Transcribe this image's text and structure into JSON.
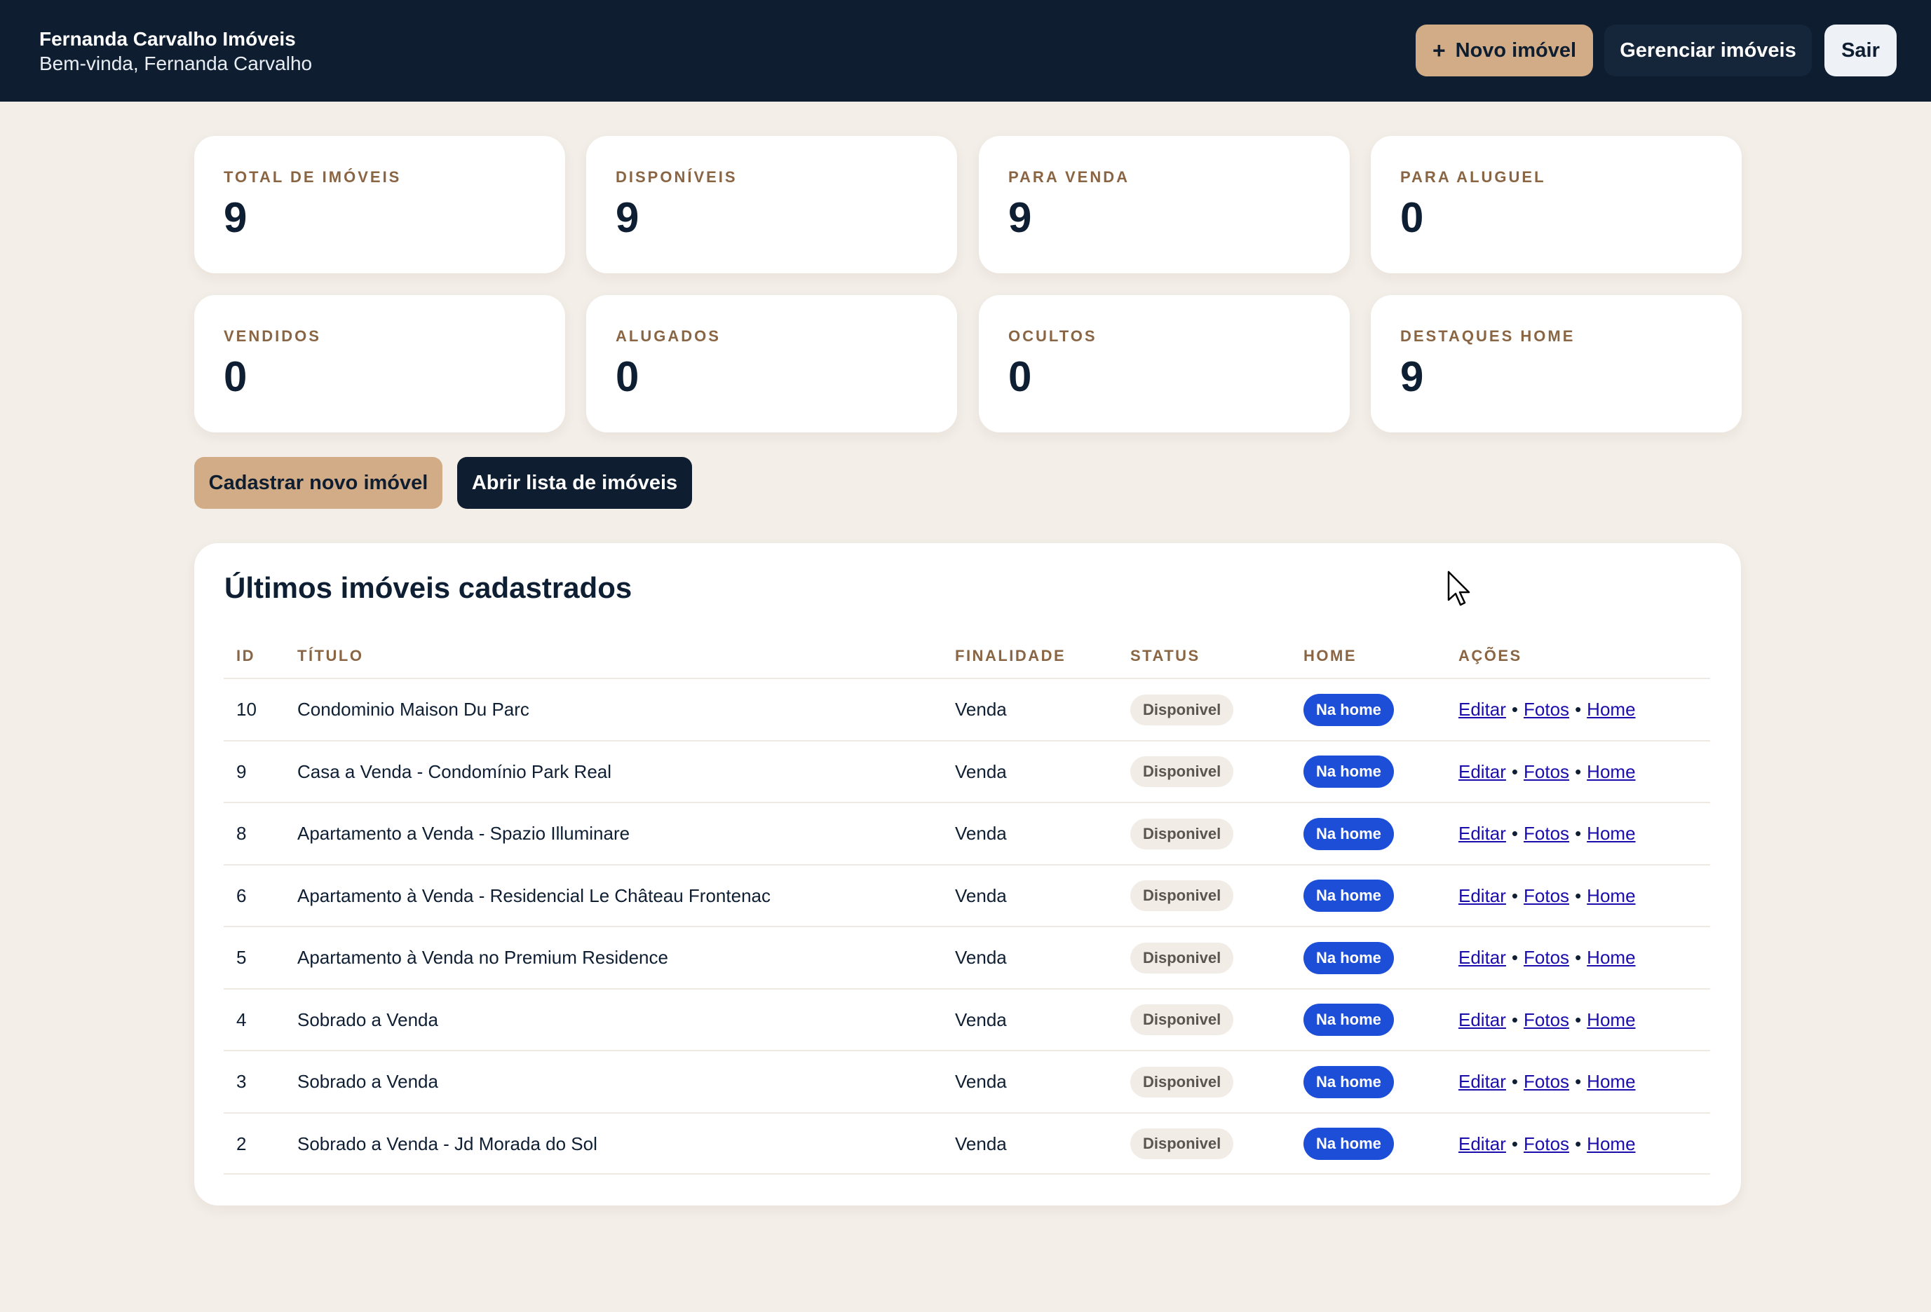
{
  "header": {
    "brand_name": "Fernanda Carvalho Imóveis",
    "welcome": "Bem-vinda, Fernanda Carvalho",
    "novo_imovel_label": "Novo imóvel",
    "gerenciar_label": "Gerenciar imóveis",
    "sair_label": "Sair",
    "colors": {
      "bar": "#0e1e30",
      "accent": "#d2ac86"
    }
  },
  "stats": [
    {
      "label": "TOTAL DE IMÓVEIS",
      "value": "9"
    },
    {
      "label": "DISPONÍVEIS",
      "value": "9"
    },
    {
      "label": "PARA VENDA",
      "value": "9"
    },
    {
      "label": "PARA ALUGUEL",
      "value": "0"
    },
    {
      "label": "VENDIDOS",
      "value": "0"
    },
    {
      "label": "ALUGADOS",
      "value": "0"
    },
    {
      "label": "OCULTOS",
      "value": "0"
    },
    {
      "label": "DESTAQUES HOME",
      "value": "9"
    }
  ],
  "actions": {
    "cadastrar_label": "Cadastrar novo imóvel",
    "abrir_label": "Abrir lista de imóveis"
  },
  "table": {
    "title": "Últimos imóveis cadastrados",
    "headers": [
      "ID",
      "TÍTULO",
      "FINALIDADE",
      "STATUS",
      "HOME",
      "AÇÕES"
    ],
    "action_links": [
      "Editar",
      "Fotos",
      "Home"
    ],
    "rows": [
      {
        "id": "10",
        "titulo": "Condominio Maison Du Parc",
        "finalidade": "Venda",
        "status": "Disponivel",
        "home": "Na home"
      },
      {
        "id": "9",
        "titulo": "Casa a Venda - Condomínio Park Real",
        "finalidade": "Venda",
        "status": "Disponivel",
        "home": "Na home"
      },
      {
        "id": "8",
        "titulo": "Apartamento a Venda - Spazio Illuminare",
        "finalidade": "Venda",
        "status": "Disponivel",
        "home": "Na home"
      },
      {
        "id": "6",
        "titulo": "Apartamento à Venda - Residencial Le Château Frontenac",
        "finalidade": "Venda",
        "status": "Disponivel",
        "home": "Na home"
      },
      {
        "id": "5",
        "titulo": "Apartamento à Venda no Premium Residence",
        "finalidade": "Venda",
        "status": "Disponivel",
        "home": "Na home"
      },
      {
        "id": "4",
        "titulo": "Sobrado a Venda",
        "finalidade": "Venda",
        "status": "Disponivel",
        "home": "Na home"
      },
      {
        "id": "3",
        "titulo": "Sobrado a Venda",
        "finalidade": "Venda",
        "status": "Disponivel",
        "home": "Na home"
      },
      {
        "id": "2",
        "titulo": "Sobrado a Venda - Jd Morada do Sol",
        "finalidade": "Venda",
        "status": "Disponivel",
        "home": "Na home"
      }
    ]
  }
}
